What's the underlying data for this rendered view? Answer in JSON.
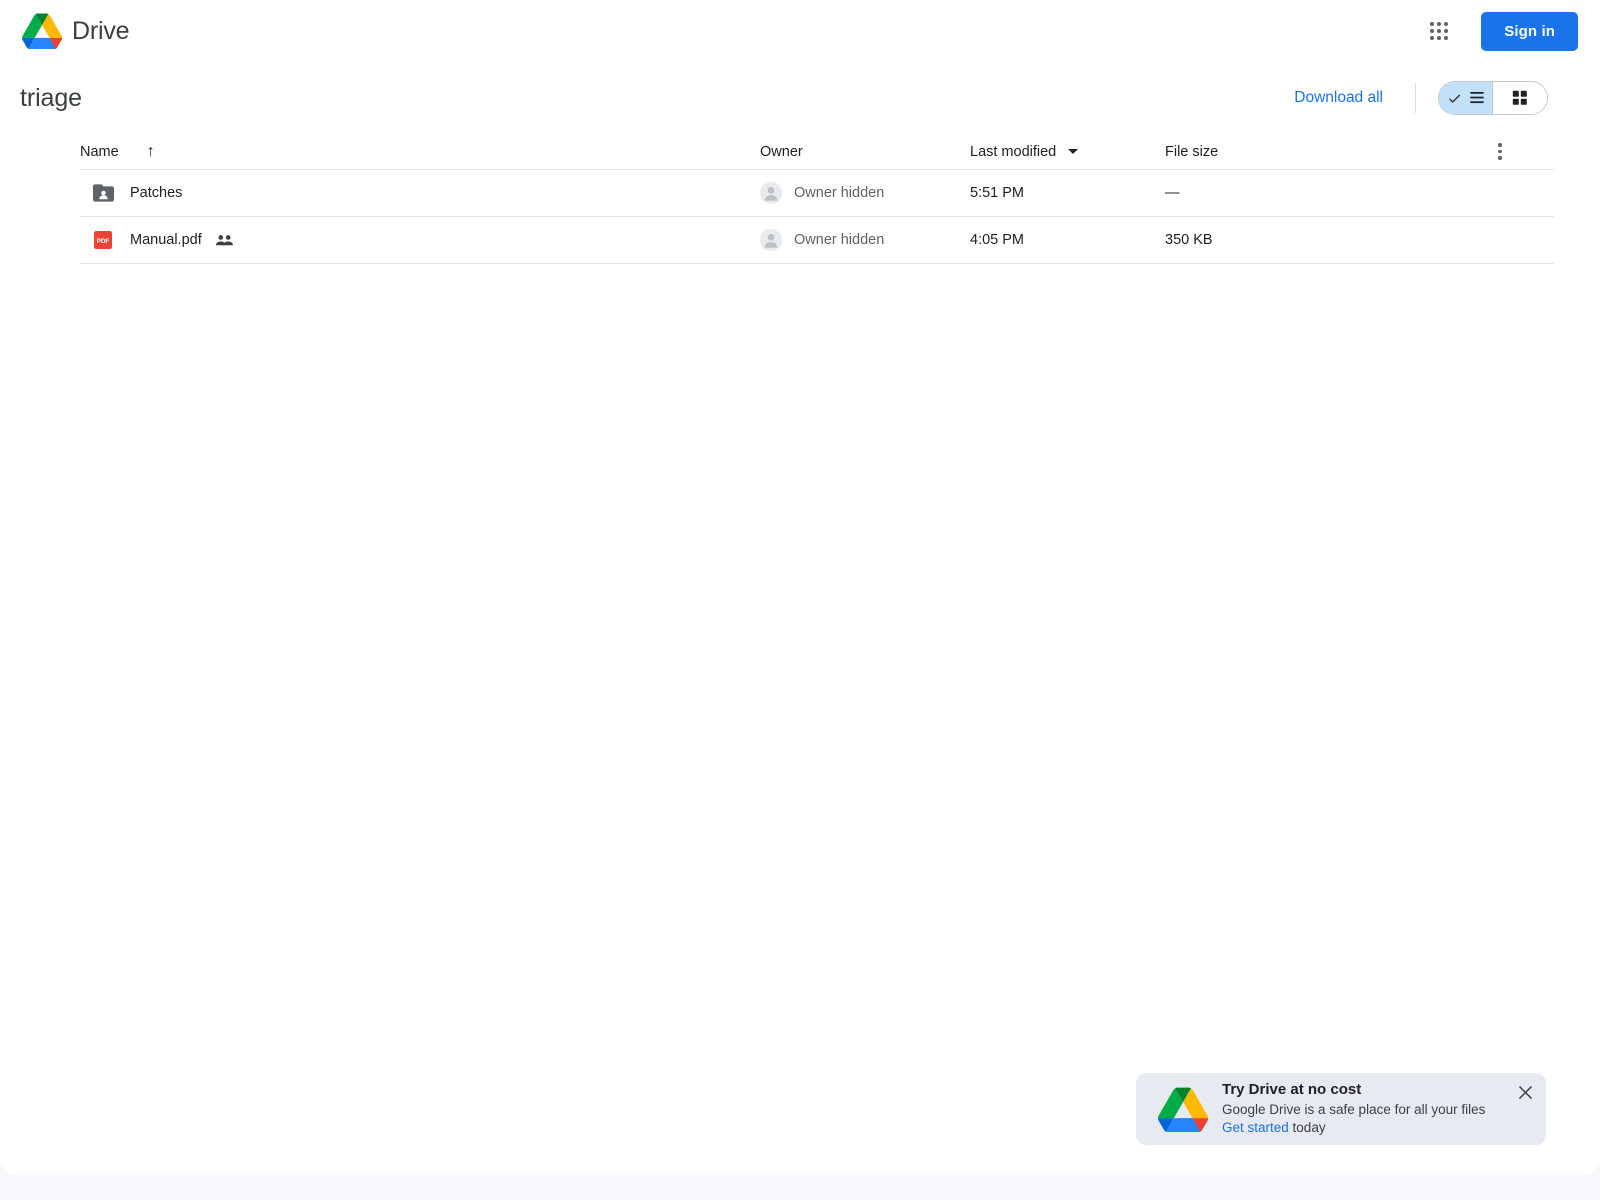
{
  "topbar": {
    "brand_name": "Drive",
    "apps_icon": "apps-grid-icon",
    "signin_label": "Sign in"
  },
  "title_row": {
    "folder_name": "triage",
    "download_all_label": "Download all",
    "list_view_icon": "list-view-icon",
    "grid_view_icon": "grid-view-icon",
    "active_view": "list"
  },
  "table": {
    "headers": {
      "name": "Name",
      "sort_arrow": "↑",
      "owner": "Owner",
      "last_modified": "Last modified",
      "file_size": "File size",
      "menu_icon": "more-vert-icon"
    },
    "rows": [
      {
        "icon": "shared-folder-icon",
        "name": "Patches",
        "shared": false,
        "owner": "Owner hidden",
        "last_modified": "5:51 PM",
        "file_size": "—"
      },
      {
        "icon": "pdf-file-icon",
        "icon_label": "PDF",
        "name": "Manual.pdf",
        "shared": true,
        "owner": "Owner hidden",
        "last_modified": "4:05 PM",
        "file_size": "350 KB"
      }
    ]
  },
  "promo": {
    "title": "Try Drive at no cost",
    "body": "Google Drive is a safe place for all your files",
    "link_label": "Get started",
    "link_suffix": " today",
    "close_icon": "close-icon"
  },
  "colors": {
    "accent_blue": "#1a73e8",
    "toggle_active": "#c2e0f8",
    "promo_bg": "#e8eaf2",
    "pdf_red": "#ea4335",
    "folder_gray": "#5f6368",
    "page_bg": "#f8f9fd"
  }
}
